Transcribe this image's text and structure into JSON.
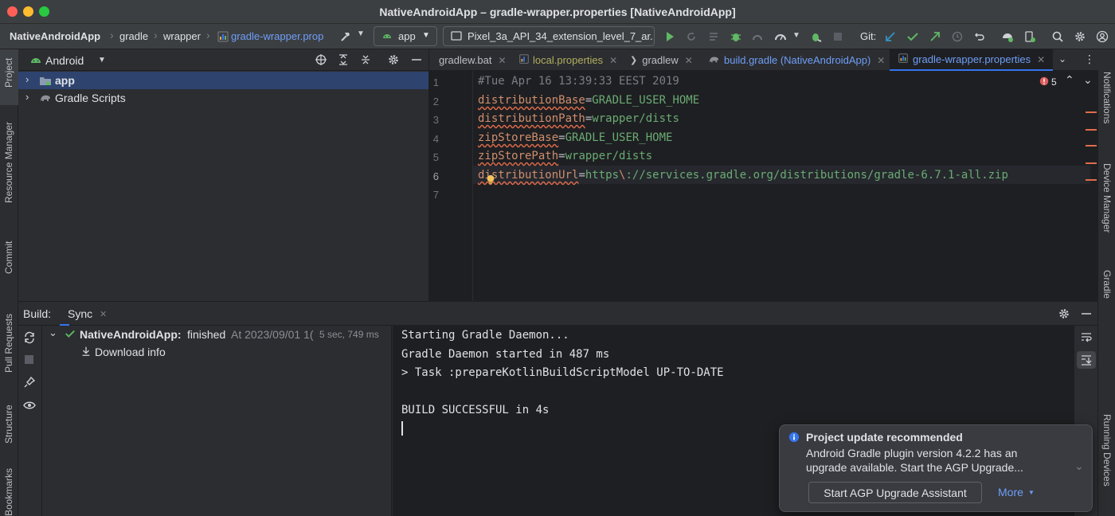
{
  "window": {
    "title": "NativeAndroidApp – gradle-wrapper.properties [NativeAndroidApp]"
  },
  "toolbar": {
    "breadcrumb": [
      "NativeAndroidApp",
      "gradle",
      "wrapper",
      "gradle-wrapper.prop"
    ],
    "run_config": "app",
    "device": "Pixel_3a_API_34_extension_level_7_ar...",
    "git_label": "Git:"
  },
  "left_strip": {
    "items": [
      "Project",
      "Resource Manager",
      "Commit",
      "Pull Requests",
      "Structure",
      "Bookmarks"
    ]
  },
  "right_strip": {
    "items": [
      "Notifications",
      "Device Manager",
      "Gradle",
      "Running Devices"
    ]
  },
  "project": {
    "view_label": "Android",
    "tree": [
      {
        "label": "app"
      },
      {
        "label": "Gradle Scripts"
      }
    ]
  },
  "editor": {
    "tabs": [
      {
        "label": "gradlew.bat"
      },
      {
        "label": "local.properties"
      },
      {
        "label": "gradlew"
      },
      {
        "label": "build.gradle (NativeAndroidApp)"
      },
      {
        "label": "gradle-wrapper.properties"
      }
    ],
    "error_count": "5",
    "line_numbers": [
      "1",
      "2",
      "3",
      "4",
      "5",
      "6",
      "7"
    ],
    "lines": [
      {
        "comment": "#Tue Apr 16 13:39:33 EEST 2019"
      },
      {
        "key": "distributionBase",
        "value": "GRADLE_USER_HOME"
      },
      {
        "key": "distributionPath",
        "value": "wrapper/dists"
      },
      {
        "key": "zipStoreBase",
        "value": "GRADLE_USER_HOME"
      },
      {
        "key": "zipStorePath",
        "value": "wrapper/dists"
      },
      {
        "key": "distributionUrl",
        "value_a": "https",
        "escape": "\\",
        "value_b": "://services.gradle.org/distributions/gradle-6.7.1-all.zip"
      }
    ]
  },
  "build": {
    "label": "Build:",
    "tab": "Sync",
    "tree": {
      "root_name": "NativeAndroidApp:",
      "root_status": "finished",
      "root_time": "At 2023/09/01 1(",
      "root_duration": "5 sec, 749 ms",
      "child": "Download info"
    },
    "console": [
      "Starting Gradle Daemon...",
      "Gradle Daemon started in 487 ms",
      "> Task :prepareKotlinBuildScriptModel UP-TO-DATE",
      "",
      "BUILD SUCCESSFUL in 4s"
    ]
  },
  "notification": {
    "title": "Project update recommended",
    "body_line1": "Android Gradle plugin version 4.2.2 has an",
    "body_line2": "upgrade available. Start the AGP Upgrade...",
    "primary_button": "Start AGP Upgrade Assistant",
    "link": "More"
  },
  "colors": {
    "accent": "#3574f0",
    "error": "#e06c4b",
    "success": "#5fb865",
    "android": "#5fb865"
  }
}
